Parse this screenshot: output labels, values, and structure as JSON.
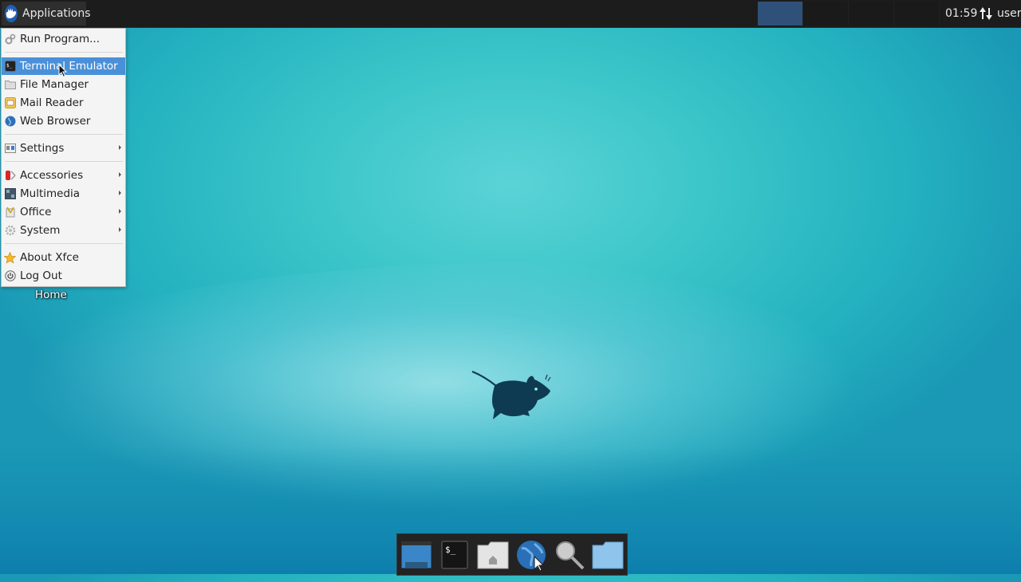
{
  "top_panel": {
    "applications_label": "Applications",
    "workspaces": [
      {
        "name": "workspace-1",
        "active": true
      },
      {
        "name": "workspace-2",
        "active": false
      },
      {
        "name": "workspace-3",
        "active": false
      },
      {
        "name": "workspace-4",
        "active": false
      }
    ],
    "clock": "01:59",
    "user": "user"
  },
  "menu": {
    "items": [
      {
        "label": "Run Program...",
        "icon": "run-program-icon",
        "submenu": false
      },
      {
        "label": "Terminal Emulator",
        "icon": "terminal-icon",
        "submenu": false,
        "highlighted": true
      },
      {
        "label": "File Manager",
        "icon": "file-manager-icon",
        "submenu": false
      },
      {
        "label": "Mail Reader",
        "icon": "mail-icon",
        "submenu": false
      },
      {
        "label": "Web Browser",
        "icon": "globe-icon",
        "submenu": false
      },
      {
        "label": "Settings",
        "icon": "settings-icon",
        "submenu": true
      },
      {
        "label": "Accessories",
        "icon": "accessories-icon",
        "submenu": true
      },
      {
        "label": "Multimedia",
        "icon": "multimedia-icon",
        "submenu": true
      },
      {
        "label": "Office",
        "icon": "office-icon",
        "submenu": true
      },
      {
        "label": "System",
        "icon": "system-gear-icon",
        "submenu": true
      },
      {
        "label": "About Xfce",
        "icon": "star-icon",
        "submenu": false
      },
      {
        "label": "Log Out",
        "icon": "power-icon",
        "submenu": false
      }
    ]
  },
  "desktop": {
    "icons": [
      {
        "label": "Home"
      }
    ]
  },
  "dock": {
    "items": [
      {
        "name": "show-desktop",
        "icon": "show-desktop-icon"
      },
      {
        "name": "terminal",
        "icon": "terminal-icon"
      },
      {
        "name": "home-folder",
        "icon": "home-folder-icon"
      },
      {
        "name": "web-browser",
        "icon": "globe-icon"
      },
      {
        "name": "app-finder",
        "icon": "magnifier-icon"
      },
      {
        "name": "folder",
        "icon": "folder-icon"
      }
    ]
  },
  "colors": {
    "panel_bg": "#1c1c1c",
    "active_workspace": "#2f5179",
    "menu_highlight": "#4a90d9",
    "menu_bg": "#f4f4f4"
  }
}
